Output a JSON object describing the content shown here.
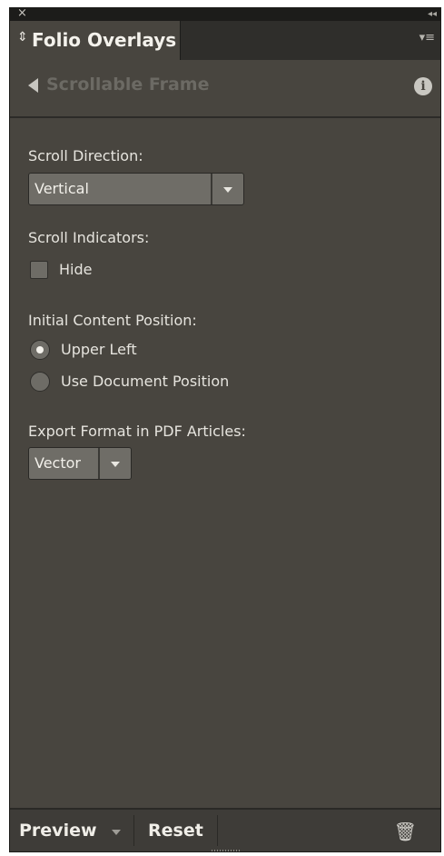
{
  "window": {
    "close_glyph": "×",
    "collapse_glyph": "◂◂",
    "menu_glyph": "▾≡"
  },
  "tab": {
    "arrows_glyph": "⇕",
    "title": "Folio Overlays"
  },
  "subheader": {
    "title": "Scrollable Frame",
    "info_glyph": "i"
  },
  "scroll_direction": {
    "label": "Scroll Direction:",
    "value": "Vertical"
  },
  "scroll_indicators": {
    "label": "Scroll Indicators:",
    "hide_label": "Hide",
    "hide_checked": false
  },
  "initial_position": {
    "label": "Initial Content Position:",
    "options": [
      {
        "label": "Upper Left",
        "selected": true
      },
      {
        "label": "Use Document Position",
        "selected": false
      }
    ]
  },
  "export_format": {
    "label": "Export Format in PDF Articles:",
    "value": "Vector"
  },
  "footer": {
    "preview_label": "Preview",
    "reset_label": "Reset",
    "trash_glyph": "🗑"
  },
  "colors": {
    "panel_bg": "#48453f",
    "tab_strip": "#2f2e2b",
    "dropdown_bg": "#6f6d67",
    "text": "#e6e4de",
    "disabled_text": "#6c6a64"
  },
  "icons": [
    "close-icon",
    "collapse-icon",
    "panel-menu-icon",
    "back-arrow-icon",
    "info-icon",
    "chevron-down-icon",
    "trash-icon"
  ]
}
